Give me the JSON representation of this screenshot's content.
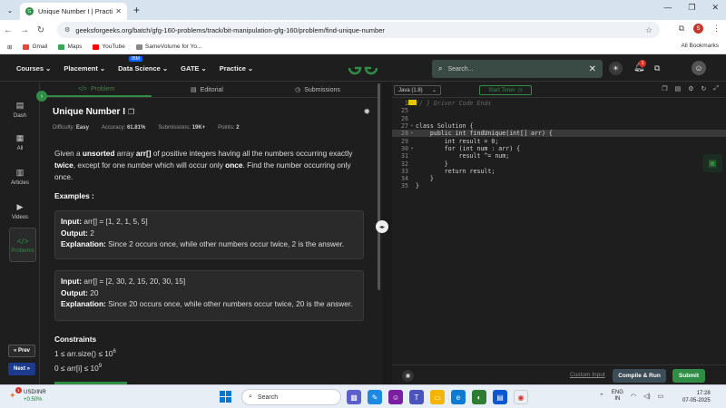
{
  "browser": {
    "tab_title": "Unique Number I | Practice | Ge",
    "url": "geeksforgeeks.org/batch/gfg-160-problems/track/bit-manipulation-gfg-160/problem/find-unique-number",
    "profile_initial": "S",
    "bookmarks": [
      "Gmail",
      "Maps",
      "YouTube",
      "SameVolume for Yo..."
    ],
    "all_bookmarks": "All Bookmarks"
  },
  "header": {
    "nav": [
      "Courses",
      "Placement",
      "Data Science",
      "GATE",
      "Practice"
    ],
    "ibm_badge": "IBM",
    "search_placeholder": "Search...",
    "notification_count": "1"
  },
  "sidebar": {
    "items": [
      "Dash",
      "All",
      "Articles",
      "Videos",
      "Problems"
    ],
    "prev": "Prev",
    "next": "Next"
  },
  "problem": {
    "tabs": [
      "Problem",
      "Editorial",
      "Submissions"
    ],
    "title": "Unique Number I",
    "difficulty_label": "Difficulty:",
    "difficulty": "Easy",
    "accuracy_label": "Accuracy:",
    "accuracy": "61.81%",
    "submissions_label": "Submissions:",
    "submissions": "19K+",
    "points_label": "Points:",
    "points": "2",
    "desc_1": "Given a ",
    "desc_unsorted": "unsorted",
    "desc_2": " array ",
    "desc_arr": "arr[]",
    "desc_3": " of positive integers having all the numbers occurring exactly ",
    "desc_twice": "twice",
    "desc_4": ", except for one number which will occur only ",
    "desc_once": "once",
    "desc_5": ". Find the number occurring only once.",
    "examples_heading": "Examples :",
    "input_label": "Input:",
    "output_label": "Output:",
    "explanation_label": "Explanation:",
    "examples": [
      {
        "input": "arr[] = [1, 2, 1, 5, 5]",
        "output": "2",
        "explanation": "Since 2 occurs once, while other numbers occur twice, 2 is the answer."
      },
      {
        "input": "arr[] = [2, 30, 2, 15, 20, 30, 15]",
        "output": "20",
        "explanation": "Since 20 occurs once, while other numbers occur twice, 20 is the answer."
      }
    ],
    "constraints_heading": "Constraints",
    "c1_text": "1 ≤  arr.size() ≤ 10",
    "c1_exp": "6",
    "c2_text": "0 ≤ arr[i] ≤ 10",
    "c2_exp": "9"
  },
  "editor": {
    "language": "Java (1.8)",
    "timer_label": "Start Timer",
    "code": [
      {
        "n": "1",
        "text": "// } Driver Code Ends",
        "type": "comment",
        "fold": ""
      },
      {
        "n": "25",
        "text": "",
        "type": "code",
        "fold": ""
      },
      {
        "n": "26",
        "text": "",
        "type": "code",
        "fold": ""
      },
      {
        "n": "27",
        "text": "class Solution {",
        "type": "code",
        "fold": "▾"
      },
      {
        "n": "28",
        "text": "    public int findUnique(int[] arr) {",
        "type": "code",
        "fold": "▾"
      },
      {
        "n": "29",
        "text": "        int result = 0;",
        "type": "code",
        "fold": ""
      },
      {
        "n": "30",
        "text": "        for (int num : arr) {",
        "type": "code",
        "fold": "▾"
      },
      {
        "n": "31",
        "text": "            result ^= num;",
        "type": "code",
        "fold": ""
      },
      {
        "n": "32",
        "text": "        }",
        "type": "code",
        "fold": ""
      },
      {
        "n": "33",
        "text": "        return result;",
        "type": "code",
        "fold": ""
      },
      {
        "n": "34",
        "text": "    }",
        "type": "code",
        "fold": ""
      },
      {
        "n": "35",
        "text": "}",
        "type": "code",
        "fold": ""
      }
    ],
    "custom_input": "Custom Input",
    "compile_run": "Compile & Run",
    "submit": "Submit"
  },
  "taskbar": {
    "stock_name": "USD/INR",
    "stock_change": "+0.50%",
    "stock_badge": "1",
    "search": "Search",
    "lang_1": "ENG",
    "lang_2": "IN",
    "time": "17:28",
    "date": "07-05-2025"
  },
  "colors": {
    "brand_green": "#2f8d46",
    "dark_bg": "#1e1e1e",
    "submit": "#2f8d46"
  }
}
